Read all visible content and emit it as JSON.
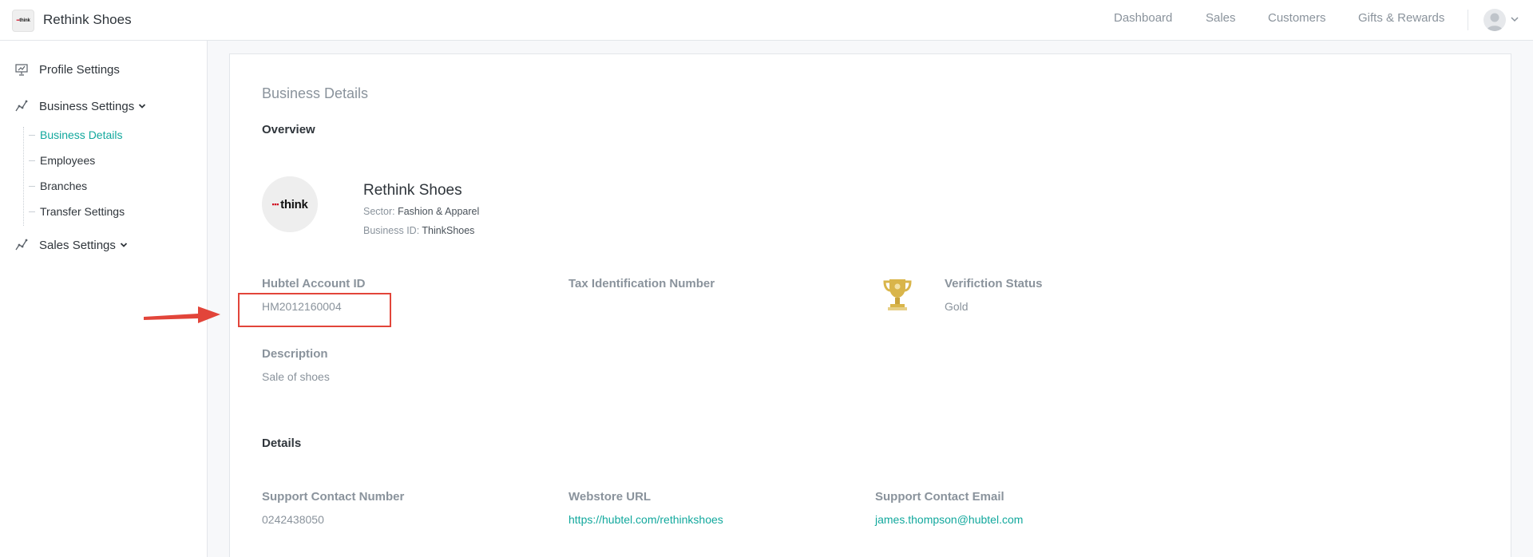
{
  "header": {
    "brand_logo_text": "think",
    "brand_name": "Rethink Shoes",
    "nav": [
      {
        "label": "Dashboard"
      },
      {
        "label": "Sales"
      },
      {
        "label": "Customers"
      },
      {
        "label": "Gifts & Rewards"
      }
    ]
  },
  "sidebar": {
    "profile_settings": "Profile Settings",
    "business_settings": "Business Settings",
    "sub_items": [
      {
        "label": "Business Details"
      },
      {
        "label": "Employees"
      },
      {
        "label": "Branches"
      },
      {
        "label": "Transfer Settings"
      }
    ],
    "sales_settings": "Sales Settings"
  },
  "main": {
    "page_title": "Business Details",
    "overview_title": "Overview",
    "business": {
      "logo_text": "think",
      "name": "Rethink Shoes",
      "sector_label": "Sector:",
      "sector_value": "Fashion & Apparel",
      "business_id_label": "Business ID:",
      "business_id_value": "ThinkShoes"
    },
    "fields": {
      "hubtel_account_id_label": "Hubtel Account ID",
      "hubtel_account_id_value": "HM2012160004",
      "tax_id_label": "Tax Identification Number",
      "tax_id_value": "",
      "verification_status_label": "Verifiction Status",
      "verification_status_value": "Gold",
      "description_label": "Description",
      "description_value": "Sale of shoes"
    },
    "details_title": "Details",
    "details": {
      "support_contact_number_label": "Support Contact Number",
      "support_contact_number_value": "0242438050",
      "webstore_url_label": "Webstore URL",
      "webstore_url_value": "https://hubtel.com/rethinkshoes",
      "support_contact_email_label": "Support Contact Email",
      "support_contact_email_value": "james.thompson@hubtel.com"
    }
  },
  "colors": {
    "accent": "#12a89d",
    "annotation_red": "#e2453a",
    "trophy_gold": "#d9b54a"
  }
}
